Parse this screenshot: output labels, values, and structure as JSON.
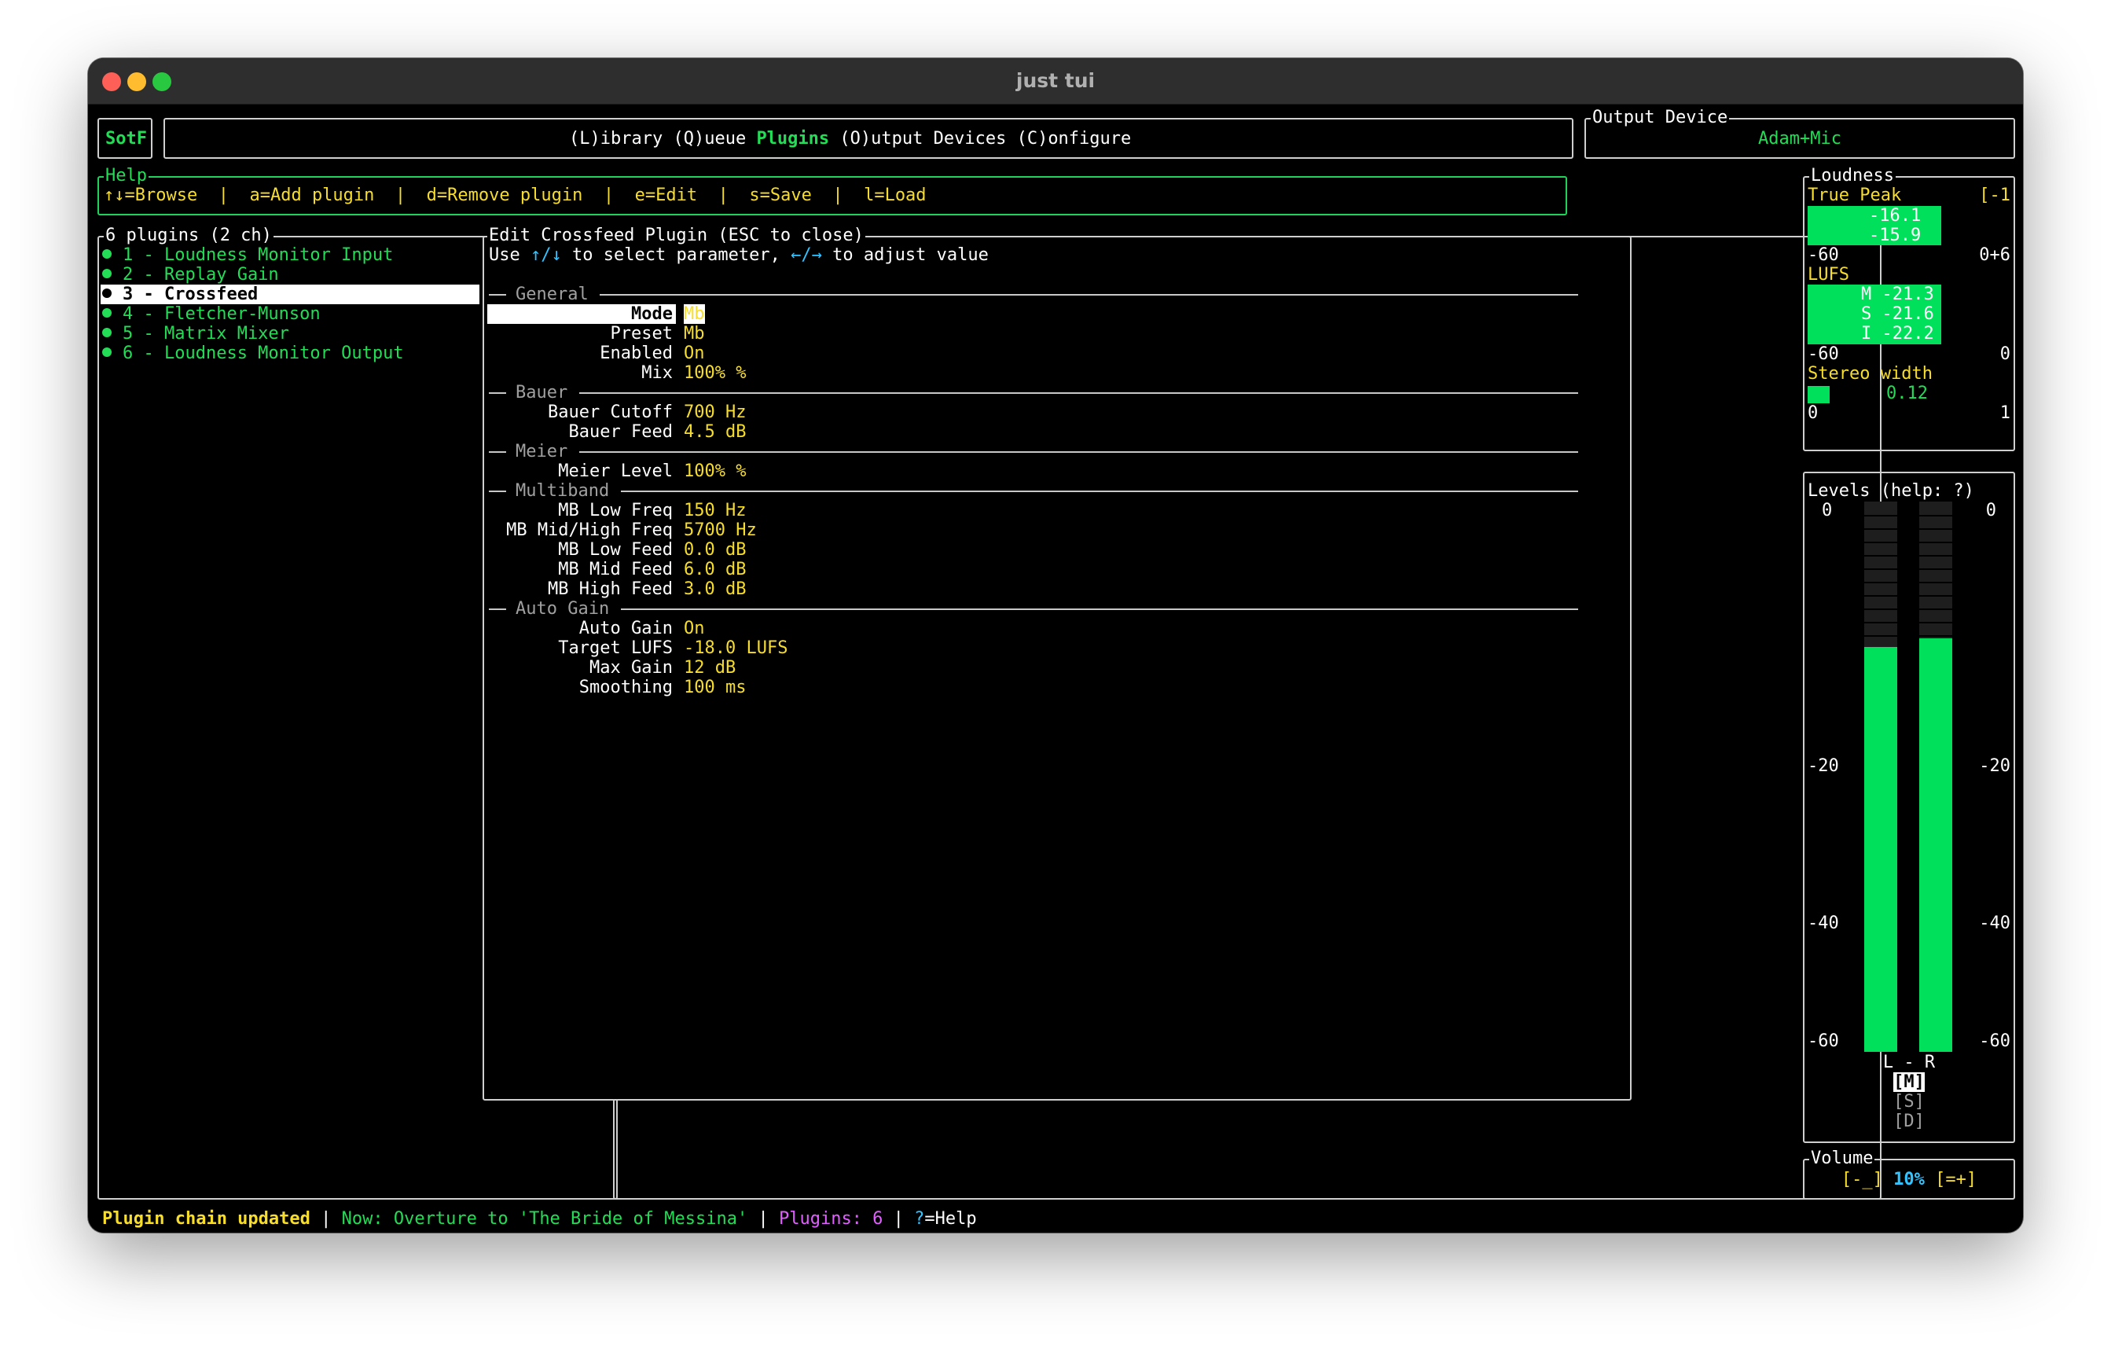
{
  "window": {
    "title": "just tui"
  },
  "tabs": {
    "brand": "SotF",
    "library": "(L)ibrary",
    "queue": "(Q)ueue",
    "plugins": "Plugins",
    "output": "(O)utput Devices",
    "configure": "(C)onfigure"
  },
  "output_device": {
    "title": "Output Device",
    "value": "Adam+Mic"
  },
  "help": {
    "title": "Help",
    "items": [
      "↑↓=Browse",
      "a=Add plugin",
      "d=Remove plugin",
      "e=Edit",
      "s=Save",
      "l=Load"
    ],
    "separator": "|"
  },
  "plugin_list": {
    "title": "6 plugins (2 ch)",
    "items": [
      {
        "label": "1 - Loudness Monitor Input"
      },
      {
        "label": "2 - Replay Gain"
      },
      {
        "label": "3 - Crossfeed",
        "selected": true
      },
      {
        "label": "4 - Fletcher-Munson"
      },
      {
        "label": "5 - Matrix Mixer"
      },
      {
        "label": "6 - Loudness Monitor Output"
      }
    ]
  },
  "editor": {
    "title": "Edit Crossfeed Plugin (ESC to close)",
    "instructions": {
      "use": "Use",
      "updown": "↑/↓",
      "select": "to select parameter,",
      "leftright": "←/→",
      "adjust": "to adjust value"
    },
    "sections": [
      {
        "name": "General",
        "params": [
          {
            "label": "Mode",
            "value": "Mb",
            "selected": true
          },
          {
            "label": "Preset",
            "value": "Mb"
          },
          {
            "label": "Enabled",
            "value": "On"
          },
          {
            "label": "Mix",
            "value": "100% %"
          }
        ]
      },
      {
        "name": "Bauer",
        "params": [
          {
            "label": "Bauer Cutoff",
            "value": "700 Hz"
          },
          {
            "label": "Bauer Feed",
            "value": "4.5 dB"
          }
        ]
      },
      {
        "name": "Meier",
        "params": [
          {
            "label": "Meier Level",
            "value": "100% %"
          }
        ]
      },
      {
        "name": "Multiband",
        "params": [
          {
            "label": "MB Low Freq",
            "value": "150 Hz"
          },
          {
            "label": "MB Mid/High Freq",
            "value": "5700 Hz"
          },
          {
            "label": "MB Low Feed",
            "value": "0.0 dB"
          },
          {
            "label": "MB Mid Feed",
            "value": "6.0 dB"
          },
          {
            "label": "MB High Feed",
            "value": "3.0 dB"
          }
        ]
      },
      {
        "name": "Auto Gain",
        "params": [
          {
            "label": "Auto Gain",
            "value": "On"
          },
          {
            "label": "Target LUFS",
            "value": "-18.0 LUFS"
          },
          {
            "label": "Max Gain",
            "value": "12 dB"
          },
          {
            "label": "Smoothing",
            "value": "100 ms"
          }
        ]
      }
    ]
  },
  "loudness": {
    "title": "Loudness",
    "true_peak_label": "True Peak",
    "true_peak_range": "[-1",
    "true_peak_values": [
      "-16.1",
      "-15.9"
    ],
    "scale_min": "-60",
    "scale_max": "0+6",
    "lufs_label": "LUFS",
    "lufs_values": [
      {
        "key": "M",
        "value": "-21.3"
      },
      {
        "key": "S",
        "value": "-21.6"
      },
      {
        "key": "I",
        "value": "-22.2"
      }
    ],
    "lufs_min": "-60",
    "lufs_max": "0",
    "stereo_label": "Stereo width",
    "stereo_value": "0.12",
    "stereo_fraction": 0.12,
    "stereo_min": "0",
    "stereo_max": "1"
  },
  "levels": {
    "title": "Levels (help: ?)",
    "ticks_left": [
      "0",
      "-20",
      "-40",
      "-60"
    ],
    "ticks_right": [
      "0",
      "-20",
      "-40",
      "-60"
    ],
    "channel_label": "L - R",
    "left_level_db": -15.9,
    "right_level_db": -14.9,
    "peak_left_db": -16,
    "peak_right_db": -14,
    "modes": [
      "[M]",
      "[S]",
      "[D]"
    ],
    "active_mode": "[M]"
  },
  "volume": {
    "title": "Volume",
    "down": "[-_]",
    "value": "10%",
    "up": "[=+]"
  },
  "status": {
    "message": "Plugin chain updated",
    "now_playing": "Now: Overture to 'The Bride of Messina'",
    "plugins": "Plugins: 6",
    "help_key": "?",
    "help_text": "=Help",
    "separator": "|"
  },
  "colors": {
    "accent_green": "#22dd55",
    "meter_green": "#00e05a",
    "value_yellow": "#f7dd2c",
    "key_cyan": "#33c4ff",
    "plugins_magenta": "#e060ff"
  }
}
